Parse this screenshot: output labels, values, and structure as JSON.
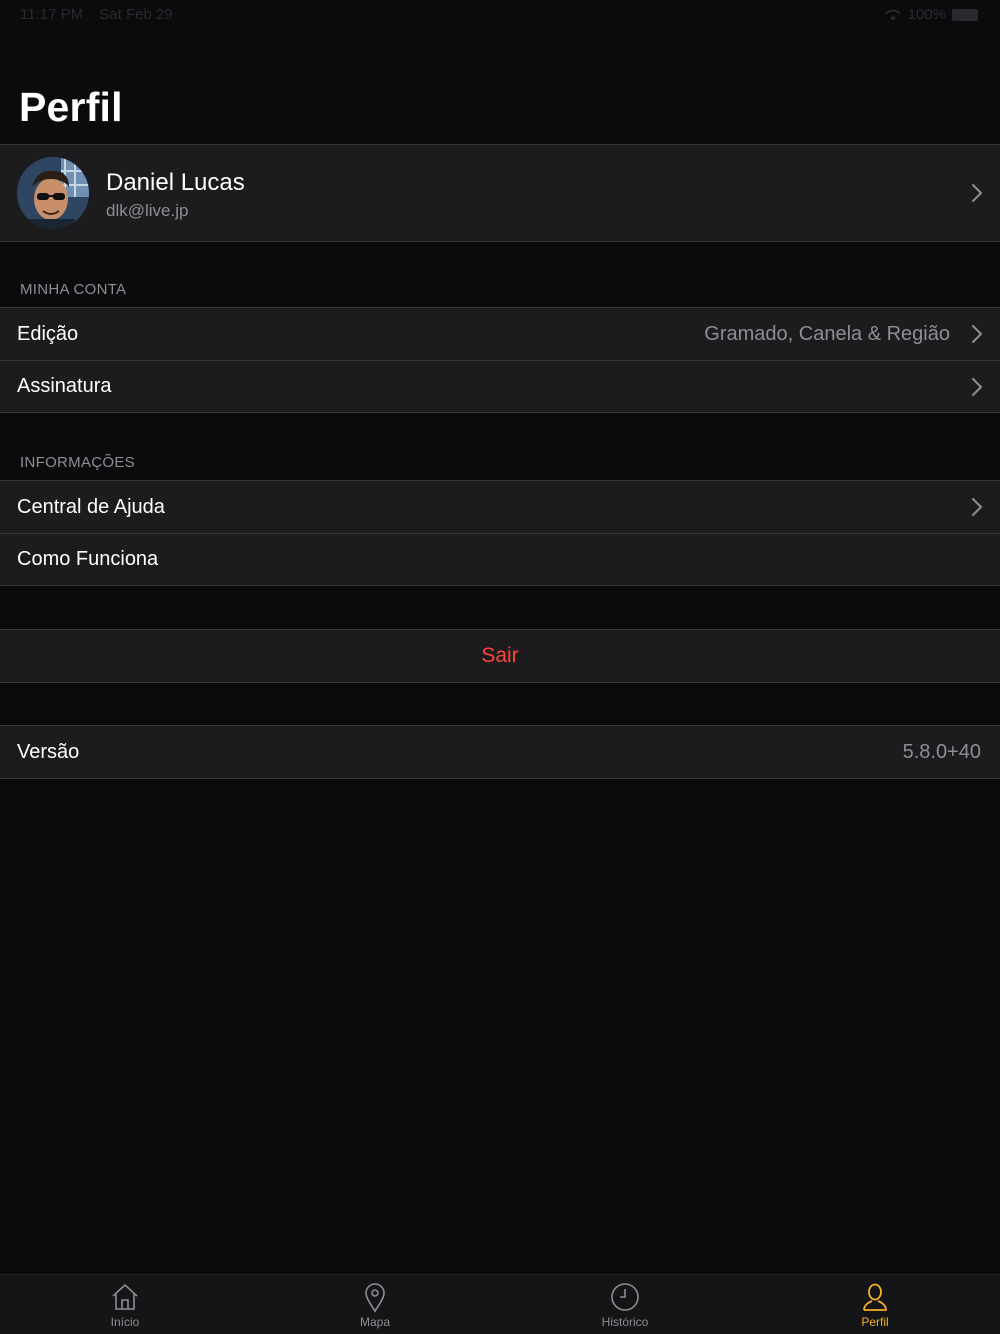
{
  "status_bar": {
    "time": "11:17 PM",
    "date": "Sat Feb 29",
    "battery": "100%"
  },
  "page_title": "Perfil",
  "profile": {
    "name": "Daniel Lucas",
    "email": "dlk@live.jp"
  },
  "sections": {
    "account": {
      "header": "MINHA CONTA",
      "edition_label": "Edição",
      "edition_value": "Gramado, Canela & Região",
      "subscription_label": "Assinatura"
    },
    "info": {
      "header": "INFORMAÇÕES",
      "help_label": "Central de Ajuda",
      "how_label": "Como Funciona"
    }
  },
  "logout_label": "Sair",
  "version": {
    "label": "Versão",
    "value": "5.8.0+40"
  },
  "tab_bar": {
    "items": [
      {
        "label": "Início",
        "icon": "home-icon"
      },
      {
        "label": "Mapa",
        "icon": "map-pin-icon"
      },
      {
        "label": "Histórico",
        "icon": "clock-icon"
      },
      {
        "label": "Perfil",
        "icon": "person-icon"
      }
    ],
    "active_index": 3
  },
  "colors": {
    "background": "#0b0b0d",
    "cell": "#1c1c1e",
    "destructive": "#ff453a",
    "accent": "#f5b026",
    "secondary_text": "#8e8e93"
  }
}
